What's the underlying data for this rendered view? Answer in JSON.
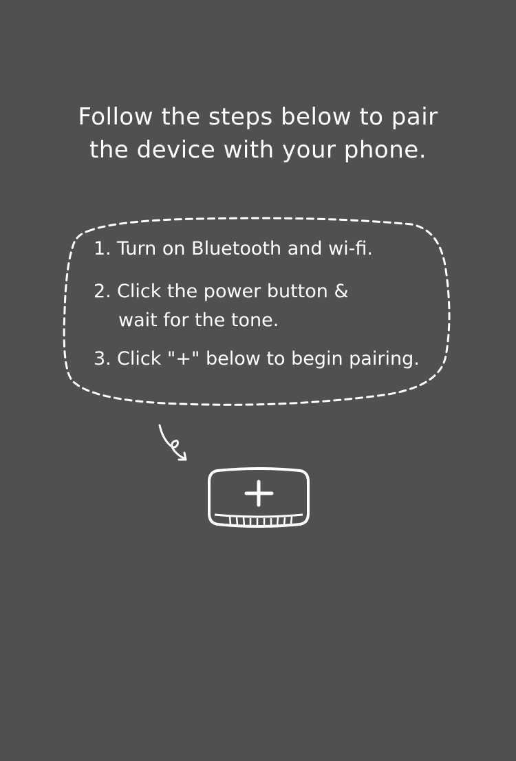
{
  "heading": {
    "line1": "Follow the steps below to pair",
    "line2": "the device with your phone."
  },
  "steps": [
    {
      "number": "1.",
      "text": "Turn on Bluetooth and wi-fi."
    },
    {
      "number": "2.",
      "text": "Click the power button &",
      "text_cont": "wait for the tone."
    },
    {
      "number": "3.",
      "text": "Click \"+\" below to begin pairing."
    }
  ],
  "add_button": {
    "icon": "plus-icon"
  },
  "arrow": {
    "icon": "curly-arrow-icon"
  },
  "colors": {
    "background": "#505050",
    "foreground": "#ffffff"
  }
}
